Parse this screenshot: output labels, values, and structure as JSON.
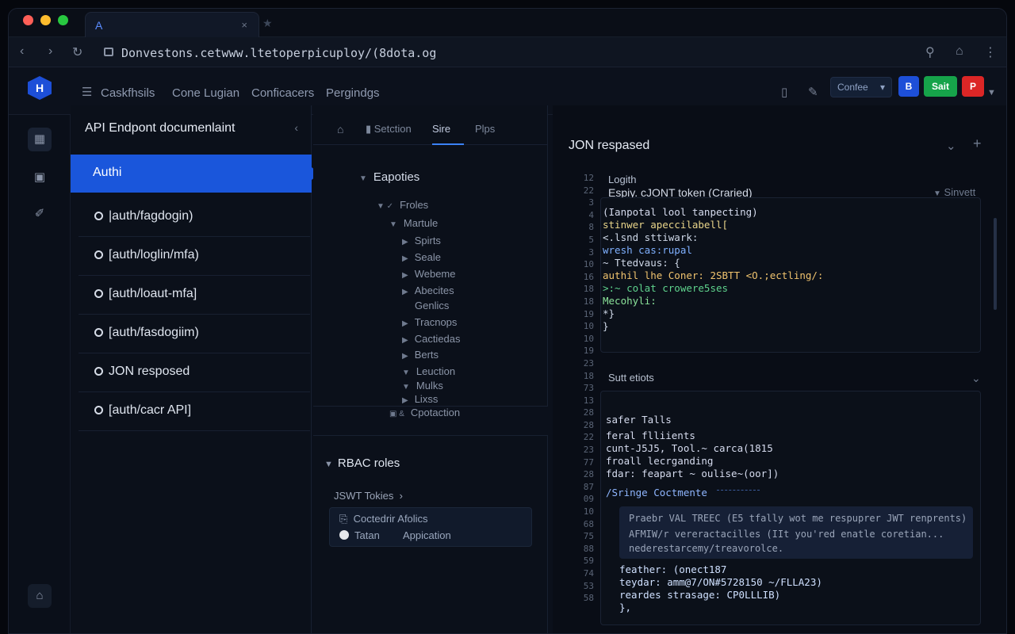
{
  "browser": {
    "tab_title": "A",
    "tab_close": "×",
    "url": "Donvestons.cetwww.ltetoperpicuploy/(8dota.og"
  },
  "header": {
    "nav": [
      "Caskfhsils",
      "Cone Lugian",
      "Conficacers",
      "Pergindgs"
    ],
    "dropdown_label": "Confee",
    "dropdown_caret": "▾",
    "blue_button": "B",
    "green_button": "Sait",
    "red_button": "P"
  },
  "endpoints": {
    "title": "API Endpont documenlaint",
    "active": "Authi",
    "items": [
      "|auth/fagdogin)",
      "[auth/loglin/mfa)",
      "[auth/loaut-mfa]",
      "[auth/fasdogiim)",
      "JON resposed",
      "[auth/cacr API]"
    ]
  },
  "tree": {
    "tabs": [
      "Setction",
      "Sire",
      "Plps"
    ],
    "root": "Eapoties",
    "nodes": [
      "Froles",
      "Martule",
      "Spirts",
      "Seale",
      "Webeme",
      "Abecites",
      "Genlics",
      "Tracnops",
      "Cactiedas",
      "Berts",
      "Leuction",
      "Mulks",
      "Lixss",
      "Cpotaction"
    ]
  },
  "rbac": {
    "title": "RBAC roles",
    "jwt": "JSWT Tokies",
    "jwt_caret": "›",
    "row1": "Coctedrir Afolics",
    "row2a": "Tatan",
    "row2b": "Appication"
  },
  "json_panel": {
    "title": "JON respased",
    "header_lines": [
      "Logith",
      "Espiy. cJONT token (Craried)"
    ],
    "header_right": "Sinvett",
    "gutter": [
      "12",
      "22",
      "3",
      "4",
      "8",
      "5",
      "3",
      "10",
      "16",
      "18",
      "18",
      "19",
      "10",
      "10",
      "19",
      "23",
      "18",
      "73",
      "13",
      "28",
      "28",
      "22",
      "23",
      "77",
      "28",
      "87",
      "09",
      "10",
      "68",
      "75",
      "88",
      "59",
      "74",
      "53",
      "58"
    ],
    "code1": [
      "(Ianpotal lool tanpecting)",
      "stinwer apeccilabell[",
      "  <.lsnd sttiwark:",
      "   wresh cas:rupal",
      "  ~ Ttedvaus: {",
      "  authil lhe Coner: 2SBTT <O.;ectling/:",
      "  >:~ colat crowere5ses",
      "  Mecohyli:",
      "   *}",
      "}"
    ],
    "section_title": "Sutt etiots",
    "code2": [
      "safer Talls",
      "  feral flliients",
      "  cunt-J5J5, Tool.~ carca(1815",
      "  froall lecrganding",
      "  fdar: feapart ~ oulise~(oor])",
      "  /Sringe Coctmente"
    ],
    "banner": [
      "Praebr VAL TREEC (E5 tfally wot me respuprer JWT renprents)",
      "AFMIW/r vereractacilles (IIt you'red enatle coretian...",
      "nederestarcemy/treavorolce."
    ],
    "code3": [
      "  feather: (onect187",
      "  teydar: amm@7/ON#5728150 ~/FLLA23)",
      "  reardes strasage: CP0LLLIB)",
      "},"
    ]
  }
}
